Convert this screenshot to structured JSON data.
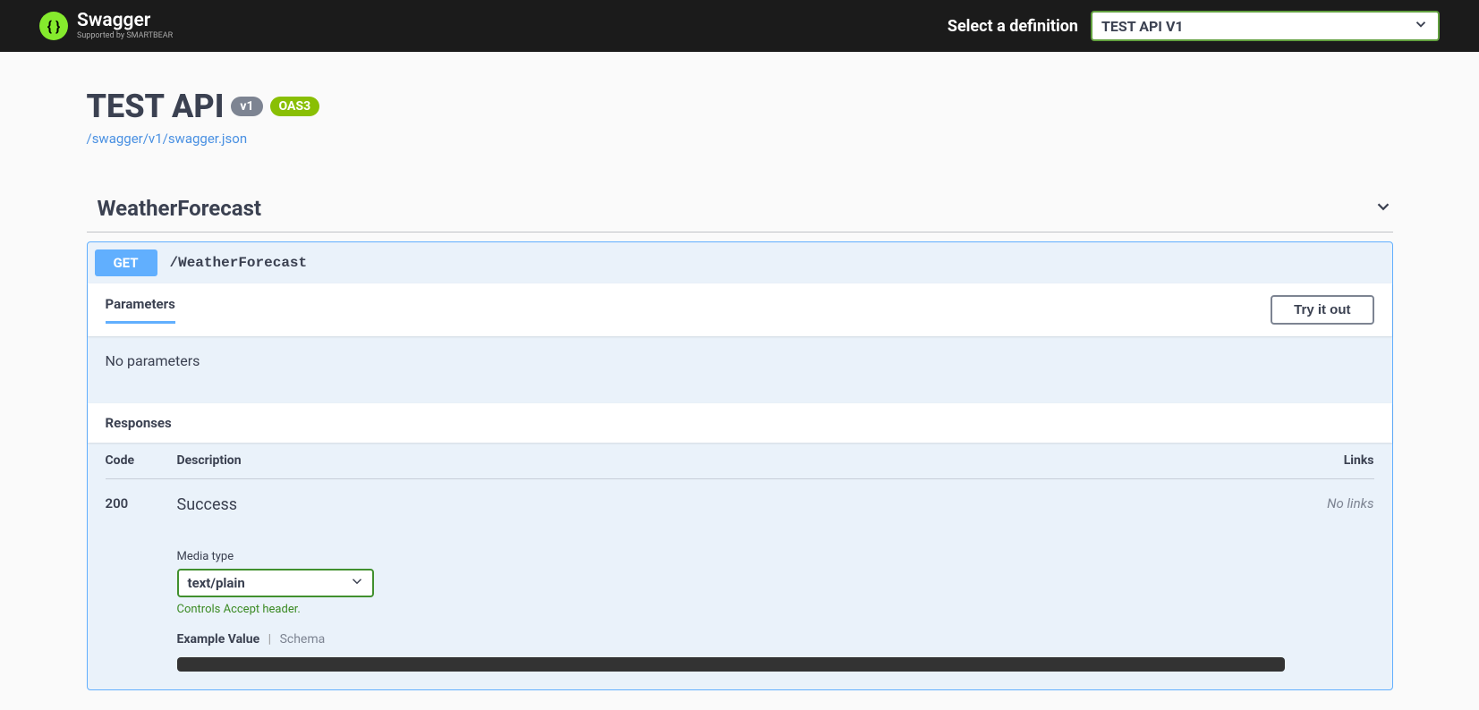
{
  "topbar": {
    "logo_text": "Swagger",
    "logo_supported": "Supported by SMARTBEAR",
    "select_label": "Select a definition",
    "definition": "TEST API V1"
  },
  "api": {
    "title": "TEST API",
    "version_badge": "v1",
    "oas_badge": "OAS3",
    "spec_url": "/swagger/v1/swagger.json"
  },
  "tag": {
    "name": "WeatherForecast"
  },
  "operation": {
    "method": "GET",
    "path": "/WeatherForecast",
    "parameters_header": "Parameters",
    "try_button": "Try it out",
    "no_params": "No parameters",
    "responses_header": "Responses",
    "columns": {
      "code": "Code",
      "description": "Description",
      "links": "Links"
    },
    "response": {
      "code": "200",
      "description": "Success",
      "links": "No links",
      "media_type_label": "Media type",
      "media_type_value": "text/plain",
      "media_hint": "Controls Accept header.",
      "example_tab": "Example Value",
      "schema_tab": "Schema"
    }
  }
}
